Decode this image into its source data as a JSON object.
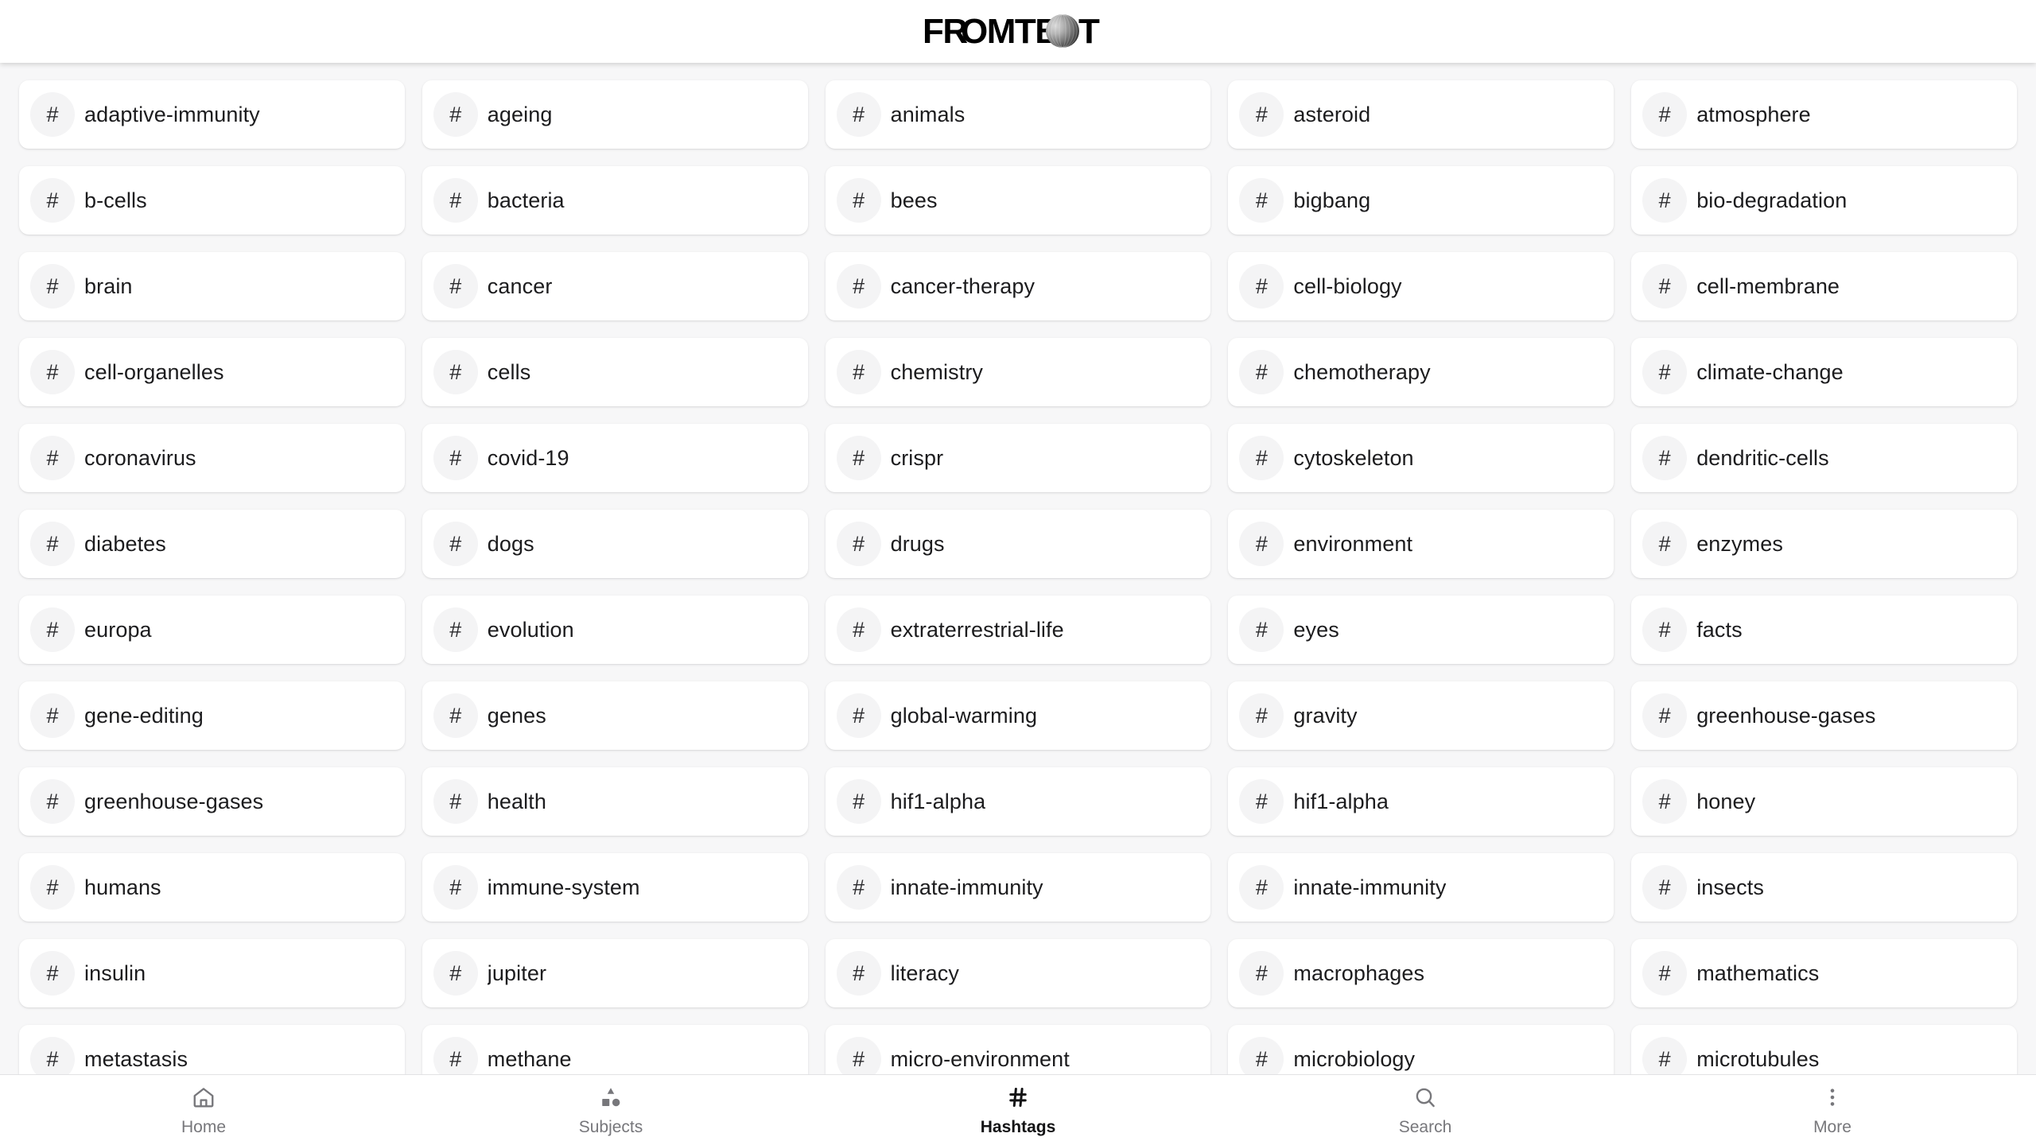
{
  "header": {
    "logo_text": "FROMTBOT",
    "logo_icon": "sphere-icon"
  },
  "hashtags": {
    "hash_symbol": "#",
    "items": [
      "adaptive-immunity",
      "ageing",
      "animals",
      "asteroid",
      "atmosphere",
      "b-cells",
      "bacteria",
      "bees",
      "bigbang",
      "bio-degradation",
      "brain",
      "cancer",
      "cancer-therapy",
      "cell-biology",
      "cell-membrane",
      "cell-organelles",
      "cells",
      "chemistry",
      "chemotherapy",
      "climate-change",
      "coronavirus",
      "covid-19",
      "crispr",
      "cytoskeleton",
      "dendritic-cells",
      "diabetes",
      "dogs",
      "drugs",
      "environment",
      "enzymes",
      "europa",
      "evolution",
      "extraterrestrial-life",
      "eyes",
      "facts",
      "gene-editing",
      "genes",
      "global-warming",
      "gravity",
      "greenhouse-gases",
      "greenhouse-gases",
      "health",
      "hif1-alpha",
      "hif1-alpha",
      "honey",
      "humans",
      "immune-system",
      "innate-immunity",
      "innate-immunity",
      "insects",
      "insulin",
      "jupiter",
      "literacy",
      "macrophages",
      "mathematics",
      "metastasis",
      "methane",
      "micro-environment",
      "microbiology",
      "microtubules"
    ]
  },
  "bottom_nav": {
    "active": "Hashtags",
    "items": [
      {
        "label": "Home",
        "icon": "home-icon"
      },
      {
        "label": "Subjects",
        "icon": "shapes-icon"
      },
      {
        "label": "Hashtags",
        "icon": "hash-icon"
      },
      {
        "label": "Search",
        "icon": "search-icon"
      },
      {
        "label": "More",
        "icon": "more-vertical-icon"
      }
    ]
  },
  "colors": {
    "background": "#f7f7f8",
    "card": "#ffffff",
    "text": "#1c1c1e",
    "muted": "#77777b",
    "active": "#131315"
  }
}
